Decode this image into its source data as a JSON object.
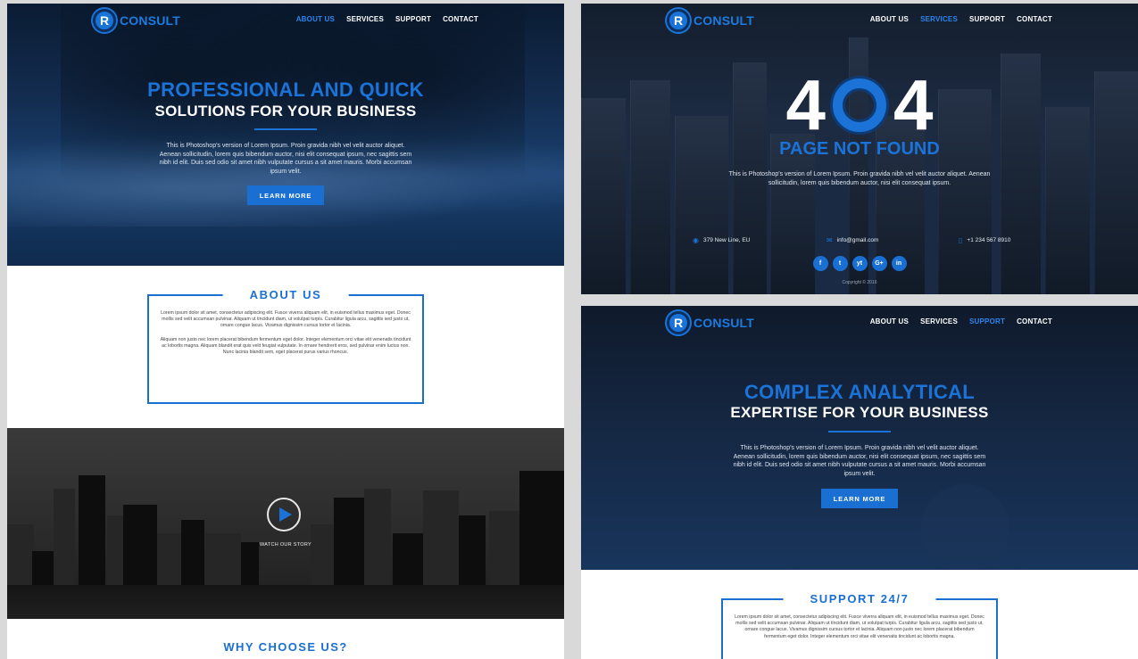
{
  "brand": {
    "logo_letter": "R",
    "name": "CONSULT",
    "accent": "#1a6fd3"
  },
  "pages": {
    "about": {
      "nav": {
        "items": [
          "ABOUT US",
          "SERVICES",
          "SUPPORT",
          "CONTACT"
        ],
        "active": "ABOUT US"
      },
      "hero": {
        "title_line1": "PROFESSIONAL AND QUICK",
        "title_line2": "SOLUTIONS FOR YOUR BUSINESS",
        "text": "This is Photoshop's version  of Lorem Ipsum. Proin gravida nibh vel velit auctor aliquet. Aenean sollicitudin, lorem quis bibendum auctor, nisi elit consequat ipsum, nec sagittis sem nibh id elit. Duis sed odio sit amet nibh vulputate cursus a sit amet mauris. Morbi accumsan ipsum velit.",
        "button": "LEARN MORE"
      },
      "about_section": {
        "title": "ABOUT US",
        "paragraph1": "Lorem ipsum dolor sit amet, consectetur adipiscing elit. Fusce viverra aliquam elit, in euismod tellus maximus eget. Donec mollis sed velit accumsan pulvinar. Aliquam ut tincidunt diam, ut volutpat turpis. Curabitur ligula arcu, sagittis sed justo ut, ornare congue lacus. Vivamus dignissim cursus tortor et lacinia.",
        "paragraph2": "Aliquam non justo nec lorem placerat bibendum fermentum eget dolor. Integer elementum orci vitae elit venenatis tincidunt ac lobortis magna. Aliquam blandit erat quis velit feugiat vulputate. In ornare hendrerit eros, sed pulvinar enim luctus non. Nunc lacinia blandit sem, eget placerat purus varius rhoncus."
      },
      "video": {
        "label": "WATCH OUR STORY",
        "icon": "play-icon"
      },
      "why_title": "WHY CHOOSE US?"
    },
    "error": {
      "nav": {
        "items": [
          "ABOUT US",
          "SERVICES",
          "SUPPORT",
          "CONTACT"
        ],
        "active": "SERVICES"
      },
      "code_left": "4",
      "code_right": "4",
      "title": "PAGE NOT FOUND",
      "text": "This is Photoshop's version  of Lorem Ipsum. Proin gravida nibh vel velit auctor aliquet. Aenean sollicitudin, lorem quis bibendum auctor, nisi elit consequat ipsum.",
      "address": "379  New Line, EU",
      "email": "info@gmail.com",
      "phone": "+1 234 567 8910",
      "socials": [
        "f",
        "t",
        "yt",
        "G+",
        "in"
      ],
      "copyright": "Copyright © 2016"
    },
    "support": {
      "nav": {
        "items": [
          "ABOUT US",
          "SERVICES",
          "SUPPORT",
          "CONTACT"
        ],
        "active": "SUPPORT"
      },
      "hero": {
        "title_line1": "COMPLEX ANALYTICAL",
        "title_line2": "EXPERTISE FOR YOUR BUSINESS",
        "text": "This is Photoshop's version  of Lorem Ipsum. Proin gravida nibh vel velit auctor aliquet. Aenean sollicitudin, lorem quis bibendum auctor, nisi elit consequat ipsum, nec sagittis sem nibh id elit. Duis sed odio sit amet nibh vulputate cursus a sit amet mauris. Morbi accumsan ipsum velit.",
        "button": "LEARN MORE"
      },
      "section": {
        "title": "SUPPORT 24/7",
        "paragraph": "Lorem ipsum dolor sit amet, consectetur adipiscing elit. Fusce viverra aliquam elit, in euismod tellus maximus eget. Donec mollis sed velit accumsan pulvinar. Aliquam ut tincidunt diam, ut volutpat turpis. Curabitur ligula arcu, sagittis sed justo ut, ornare congue lacus. Vivamus dignissim cursus tortor et lacinia.  Aliquam non justo nec lorem placerat bibendum fermentum eget dolor. Integer elementum orci vitae elit venenatis tincidunt ac lobortis magna."
      }
    }
  }
}
